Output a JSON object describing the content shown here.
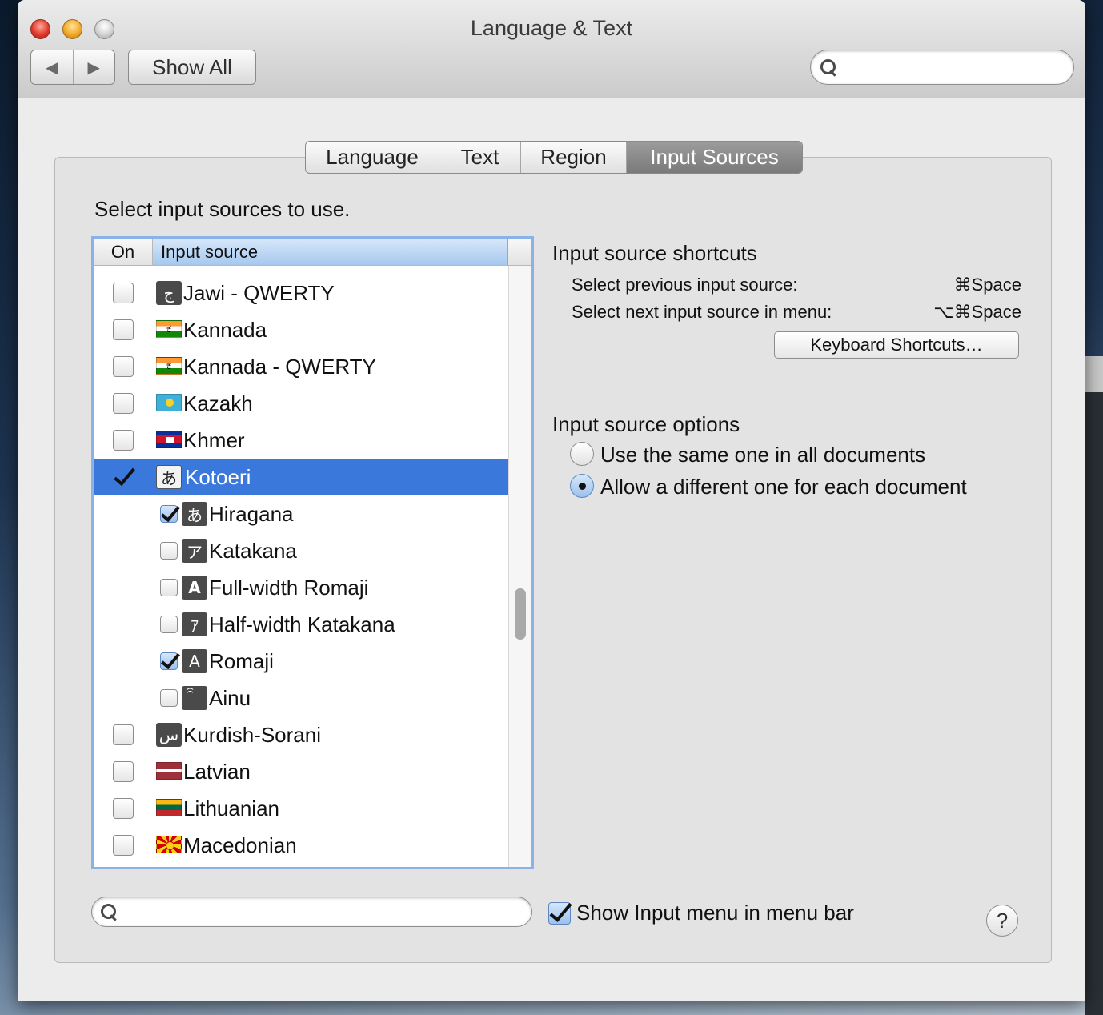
{
  "window": {
    "title": "Language & Text"
  },
  "toolbar": {
    "back_icon": "◀",
    "forward_icon": "▶",
    "show_all_label": "Show All",
    "search_placeholder": ""
  },
  "tabs": [
    {
      "label": "Language",
      "active": false
    },
    {
      "label": "Text",
      "active": false
    },
    {
      "label": "Region",
      "active": false
    },
    {
      "label": "Input Sources",
      "active": true
    }
  ],
  "input_sources": {
    "prompt": "Select input sources to use.",
    "column_on": "On",
    "column_source": "Input source",
    "rows": [
      {
        "label": "Jawi - QWERTY",
        "checked": false,
        "icon": "jawi-icon",
        "glyph": "ج"
      },
      {
        "label": "Kannada",
        "checked": false,
        "icon": "kannada-flag-icon",
        "glyph": "ಕ"
      },
      {
        "label": "Kannada - QWERTY",
        "checked": false,
        "icon": "kannada-flag-icon",
        "glyph": "ಕ"
      },
      {
        "label": "Kazakh",
        "checked": false,
        "icon": "kazakh-flag-icon"
      },
      {
        "label": "Khmer",
        "checked": false,
        "icon": "khmer-flag-icon"
      },
      {
        "label": "Kotoeri",
        "checked": true,
        "selected": true,
        "icon": "kotoeri-icon",
        "glyph": "あ"
      },
      {
        "label": "Hiragana",
        "checked": true,
        "sub": true,
        "icon": "hiragana-icon",
        "glyph": "あ"
      },
      {
        "label": "Katakana",
        "checked": false,
        "sub": true,
        "icon": "katakana-icon",
        "glyph": "ア"
      },
      {
        "label": "Full-width Romaji",
        "checked": false,
        "sub": true,
        "icon": "full-width-romaji-icon",
        "glyph": "A"
      },
      {
        "label": "Half-width Katakana",
        "checked": false,
        "sub": true,
        "icon": "half-width-katakana-icon",
        "glyph": "ｱ"
      },
      {
        "label": "Romaji",
        "checked": true,
        "sub": true,
        "icon": "romaji-icon",
        "glyph": "A"
      },
      {
        "label": "Ainu",
        "checked": false,
        "sub": true,
        "icon": "ainu-icon",
        "glyph": "ꩰ"
      },
      {
        "label": "Kurdish-Sorani",
        "checked": false,
        "icon": "kurdish-sorani-icon",
        "glyph": "س"
      },
      {
        "label": "Latvian",
        "checked": false,
        "icon": "latvian-flag-icon"
      },
      {
        "label": "Lithuanian",
        "checked": false,
        "icon": "lithuanian-flag-icon"
      },
      {
        "label": "Macedonian",
        "checked": false,
        "icon": "macedonian-flag-icon"
      }
    ],
    "filter_placeholder": ""
  },
  "shortcuts": {
    "heading": "Input source shortcuts",
    "items": [
      {
        "label": "Select previous input source:",
        "keys": "⌘Space"
      },
      {
        "label": "Select next input source in menu:",
        "keys": "⌥⌘Space"
      }
    ],
    "button_label": "Keyboard Shortcuts…"
  },
  "options": {
    "heading": "Input source options",
    "choices": [
      {
        "label": "Use the same one in all documents",
        "selected": false
      },
      {
        "label": "Allow a different one for each document",
        "selected": true
      }
    ]
  },
  "footer": {
    "show_menu_label": "Show Input menu in menu bar",
    "show_menu_checked": true,
    "help_label": "?"
  }
}
